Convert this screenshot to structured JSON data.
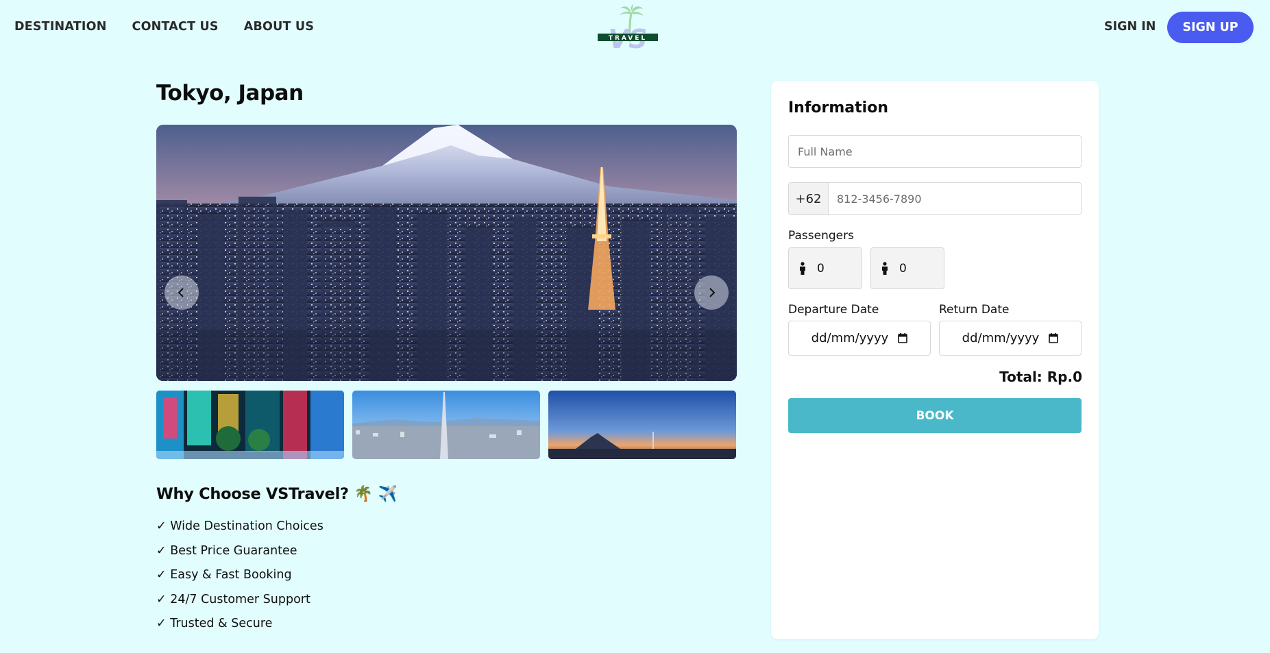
{
  "nav": {
    "links": [
      "DESTINATION",
      "CONTACT US",
      "ABOUT US"
    ],
    "logo_text": "TRAVEL",
    "logo_letters": "VS",
    "signin": "SIGN IN",
    "signup": "SIGN UP"
  },
  "destination": {
    "title": "Tokyo, Japan",
    "main_image": "tokyo-fuji-night-skyline",
    "thumbnails": [
      "shinjuku-neon-street",
      "tokyo-skytree-daytime",
      "fuji-sunset-skyline"
    ]
  },
  "why": {
    "title": "Why Choose VSTravel? 🌴 ✈️",
    "items": [
      "✓ Wide Destination Choices",
      "✓ Best Price Guarantee",
      "✓ Easy & Fast Booking",
      "✓ 24/7 Customer Support",
      "✓ Trusted & Secure"
    ]
  },
  "form": {
    "title": "Information",
    "fullname_placeholder": "Full Name",
    "phone_prefix": "+62",
    "phone_placeholder": "812-3456-7890",
    "passengers_label": "Passengers",
    "adult_count": "0",
    "child_count": "0",
    "departure_label": "Departure Date",
    "return_label": "Return Date",
    "date_placeholder": "dd/mm/yyyy",
    "total": "Total: Rp.0",
    "book_label": "BOOK"
  },
  "colors": {
    "background": "#e2fdfd",
    "signup": "#4a5cf0",
    "book": "#4bb8c9"
  }
}
